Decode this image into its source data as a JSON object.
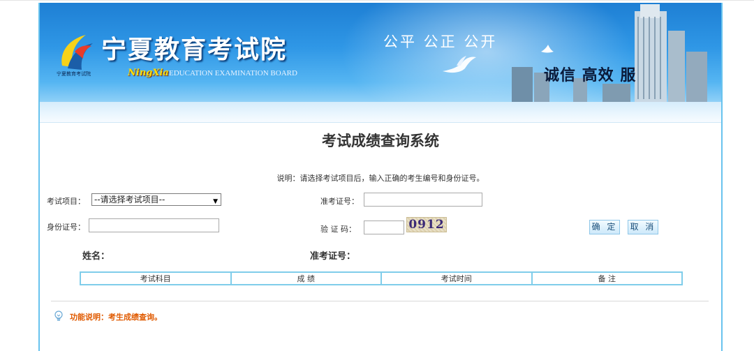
{
  "header": {
    "logo_small_text": "宁夏教育考试院",
    "site_title": "宁夏教育考试院",
    "nx_script": "NingXia",
    "subtitle_en": "EDUCATION EXAMINATION BOARD",
    "slogan": "公平 公正 公开",
    "slogan2": "诚信 高效 服"
  },
  "main": {
    "title": "考试成绩查询系统",
    "note": "说明：请选择考试项目后，输入正确的考生编号和身份证号。"
  },
  "form": {
    "exam_item_label": "考试项目：",
    "exam_item_selected": "--请选择考试项目--",
    "admission_label": "准考证号：",
    "admission_value": "",
    "id_label": "身份证号：",
    "id_value": "",
    "captcha_label": "验 证 码：",
    "captcha_value": "",
    "captcha_image_text": "0912",
    "confirm_label": "确 定",
    "cancel_label": "取 消"
  },
  "result": {
    "name_label": "姓名：",
    "admission_label": "准考证号：",
    "columns": [
      "考试科目",
      "成 绩",
      "考试时间",
      "备 注"
    ]
  },
  "footer": {
    "tip": "功能说明：考生成绩查询。"
  },
  "colors": {
    "banner_top": "#1e7fd4",
    "frame_border": "#68c3ee",
    "table_border": "#7fcdea",
    "tip_text": "#e05a00"
  }
}
